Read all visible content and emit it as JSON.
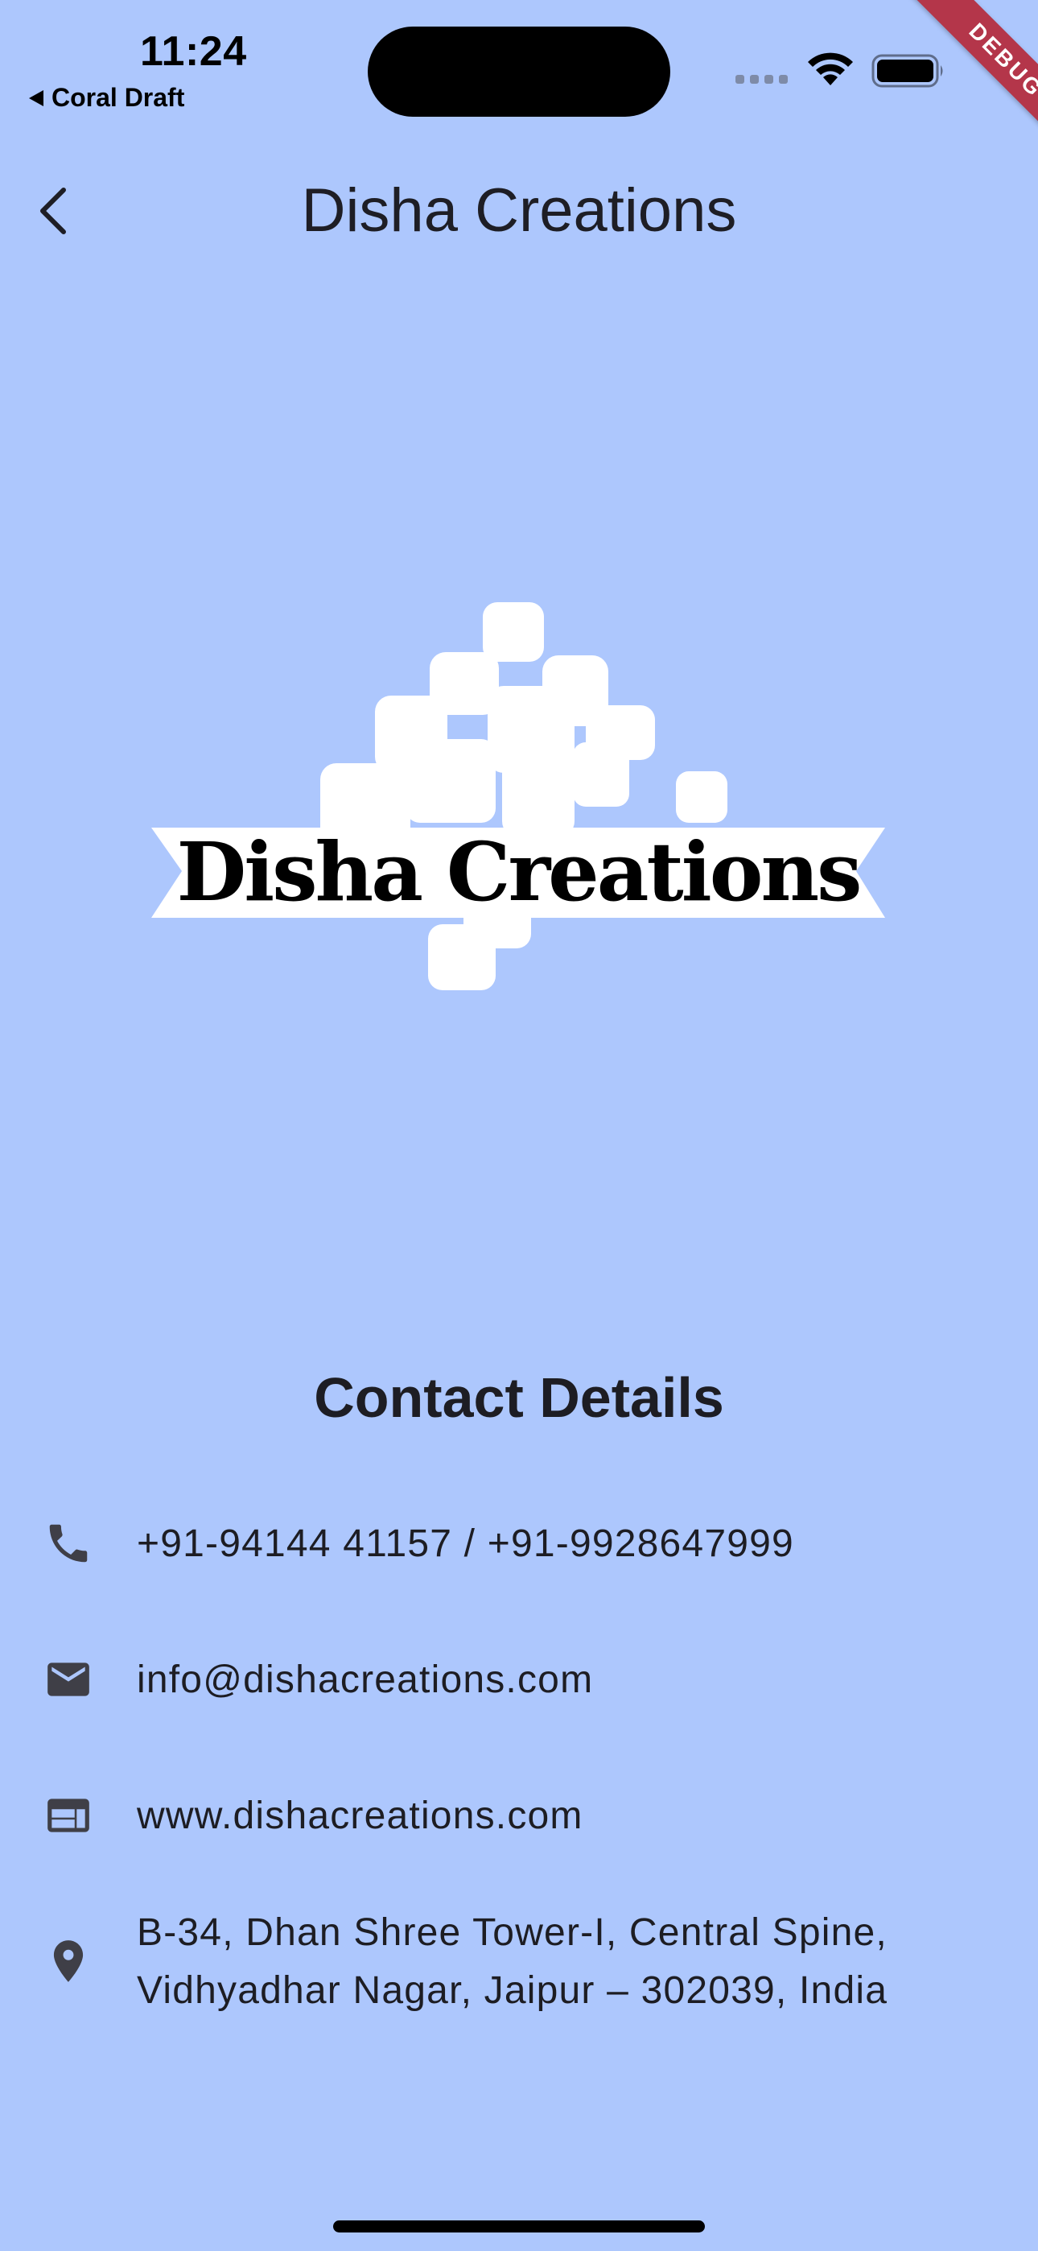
{
  "status_bar": {
    "time": "11:24",
    "back_app": "Coral Draft"
  },
  "debug_banner": "DEBUG",
  "app_bar": {
    "title": "Disha Creations"
  },
  "logo": {
    "text": "Disha Creations"
  },
  "contact": {
    "heading": "Contact Details",
    "phone": "+91-94144 41157 / +91-9928647999",
    "email": "info@dishacreations.com",
    "website": "www.dishacreations.com",
    "address_line1": "B-34, Dhan Shree Tower-I, Central Spine,",
    "address_line2": "Vidhyadhar Nagar, Jaipur – 302039, India"
  },
  "colors": {
    "background": "#adc7fd",
    "icon": "#3f3f47",
    "debug_ribbon": "#b4364a"
  },
  "icons": {
    "back": "chevron-left-icon",
    "phone": "phone-icon",
    "email": "mail-icon",
    "website": "web-icon",
    "address": "location-pin-icon"
  }
}
